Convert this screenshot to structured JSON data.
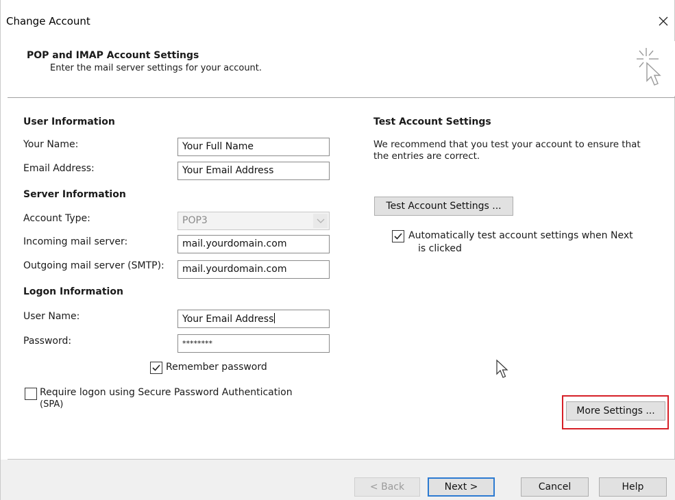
{
  "window": {
    "title": "Change Account",
    "close_glyph": "✕"
  },
  "header": {
    "title": "POP and IMAP Account Settings",
    "subtitle": "Enter the mail server settings for your account.",
    "icon": "cursor-sparkle-icon"
  },
  "user_info": {
    "section_label": "User Information",
    "name_label": "Your Name:",
    "name_value": "Your Full Name",
    "email_label": "Email Address:",
    "email_value": "Your Email Address"
  },
  "server_info": {
    "section_label": "Server Information",
    "account_type_label": "Account Type:",
    "account_type_value": "POP3",
    "incoming_label": "Incoming mail server:",
    "incoming_value": "mail.yourdomain.com",
    "outgoing_label": "Outgoing mail server (SMTP):",
    "outgoing_value": "mail.yourdomain.com"
  },
  "logon_info": {
    "section_label": "Logon Information",
    "username_label": "User Name:",
    "username_value": "Your Email Address",
    "password_label": "Password:",
    "password_value": "********",
    "remember_label": "Remember password",
    "remember_checked": true,
    "spa_label_line1": "Require logon using Secure Password Authentication",
    "spa_label_line2": "(SPA)",
    "spa_checked": false
  },
  "test_settings": {
    "section_label": "Test Account Settings",
    "description_line1": "We recommend that you test your account to ensure that",
    "description_line2": "the entries are correct.",
    "test_button": "Test Account Settings ...",
    "auto_test_line1": "Automatically test account settings when Next",
    "auto_test_line2": "is clicked",
    "auto_test_checked": true
  },
  "more_settings_button": "More Settings ...",
  "footer": {
    "back_button": "< Back",
    "next_button": "Next >",
    "cancel_button": "Cancel",
    "help_button": "Help"
  },
  "colors": {
    "highlight": "#d61f26",
    "default_button_border": "#2b7ad1",
    "footer_bg": "#f0f0f0"
  }
}
